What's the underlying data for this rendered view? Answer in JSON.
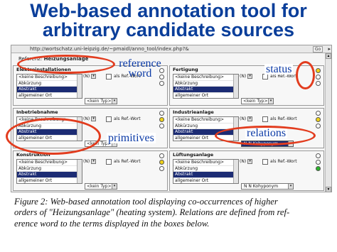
{
  "slide": {
    "title_line1": "Web-based annotation tool for",
    "title_line2": "arbitrary candidate sources"
  },
  "browser": {
    "url": "http://wortschatz.uni-leipzig.de/~pmaidl/anno_tool/index.php?&",
    "go_label": "Go"
  },
  "reference": {
    "label": "Referenz:",
    "value": "Heizungsanlage"
  },
  "panels": [
    {
      "title": "Elektroinstallationen",
      "n": "(N)",
      "as_ref": "als Ref.-Wort",
      "options": [
        "<keine Beschreibung>",
        "Abkürzung",
        "Abstrakt",
        "allgemeiner Ort"
      ],
      "selected": 3,
      "typ": "<kein Typ>",
      "relation": "",
      "lights": [
        "#ffffff",
        "#ffffff",
        "#ffffff"
      ]
    },
    {
      "title": "Fertigung",
      "n": "(N)",
      "as_ref": "als Ref.-Wort",
      "options": [
        "<keine Beschreibung>",
        "Abkürzung",
        "Abstrakt",
        "allgemeiner Ort"
      ],
      "selected": 3,
      "typ": "<kein Typ>",
      "relation": "",
      "lights": [
        "#f0d218",
        "#ffffff",
        "#ffffff"
      ]
    },
    {
      "title": "Inbetriebnahme",
      "n": "(N)",
      "as_ref": "als Ref.-Wort",
      "options": [
        "<keine Beschreibung>",
        "Abkürzung",
        "Abstrakt",
        "allgemeiner Ort"
      ],
      "selected": 3,
      "typ": "<kein Typ>",
      "relation": "",
      "lights": [
        "#ffffff",
        "#f0d218",
        "#ffffff"
      ]
    },
    {
      "title": "Industrieanlage",
      "n": "(N)",
      "as_ref": "als Ref.-Wort",
      "options": [
        "<keine Beschreibung>",
        "Abkürzung",
        "Abstrakt",
        "allgemeiner Ort"
      ],
      "selected": 3,
      "typ": "<kein Typ>",
      "relation": "N N Kohyponym",
      "lights": [
        "#ffffff",
        "#f0d218",
        "#ffffff"
      ]
    },
    {
      "title": "Konstruktion",
      "n": "(N)",
      "as_ref": "als Ref.-Wort",
      "options": [
        "<keine Beschreibung>",
        "Abkürzung",
        "Abstrakt",
        "allgemeiner Ort"
      ],
      "selected": 3,
      "typ": "<kein Typ>",
      "relation": "",
      "lights": [
        "#ffffff",
        "#f0d218",
        "#ffffff"
      ]
    },
    {
      "title": "Lüftungsanlage",
      "n": "(N)",
      "as_ref": "als Ref.-Wort",
      "options": [
        "<keine Beschreibung>",
        "Abkürzung",
        "Abstrakt",
        "allgemeiner Ort"
      ],
      "selected": 3,
      "typ": "",
      "relation": "N N Kohyponym",
      "lights": [
        "#ffffff",
        "#ffffff",
        "#2bb52b"
      ]
    }
  ],
  "annotations": {
    "reference_word_1": "reference",
    "reference_word_2": "word",
    "status": "status",
    "relations": "relations",
    "primitives": "primitives"
  },
  "colors": {
    "title": "#0a3e9a",
    "annotation_text": "#0b3aa6",
    "ring": "#e23c1e",
    "selection": "#1c2c74"
  },
  "caption": {
    "line1": "Figure 2: Web-based annotation tool displaying co-occurrences of higher",
    "line2": "orders of \"Heizungsanlage\" (heating system). Relations are defined from ref-",
    "line3": "erence word to the terms displayed in the boxes below."
  }
}
